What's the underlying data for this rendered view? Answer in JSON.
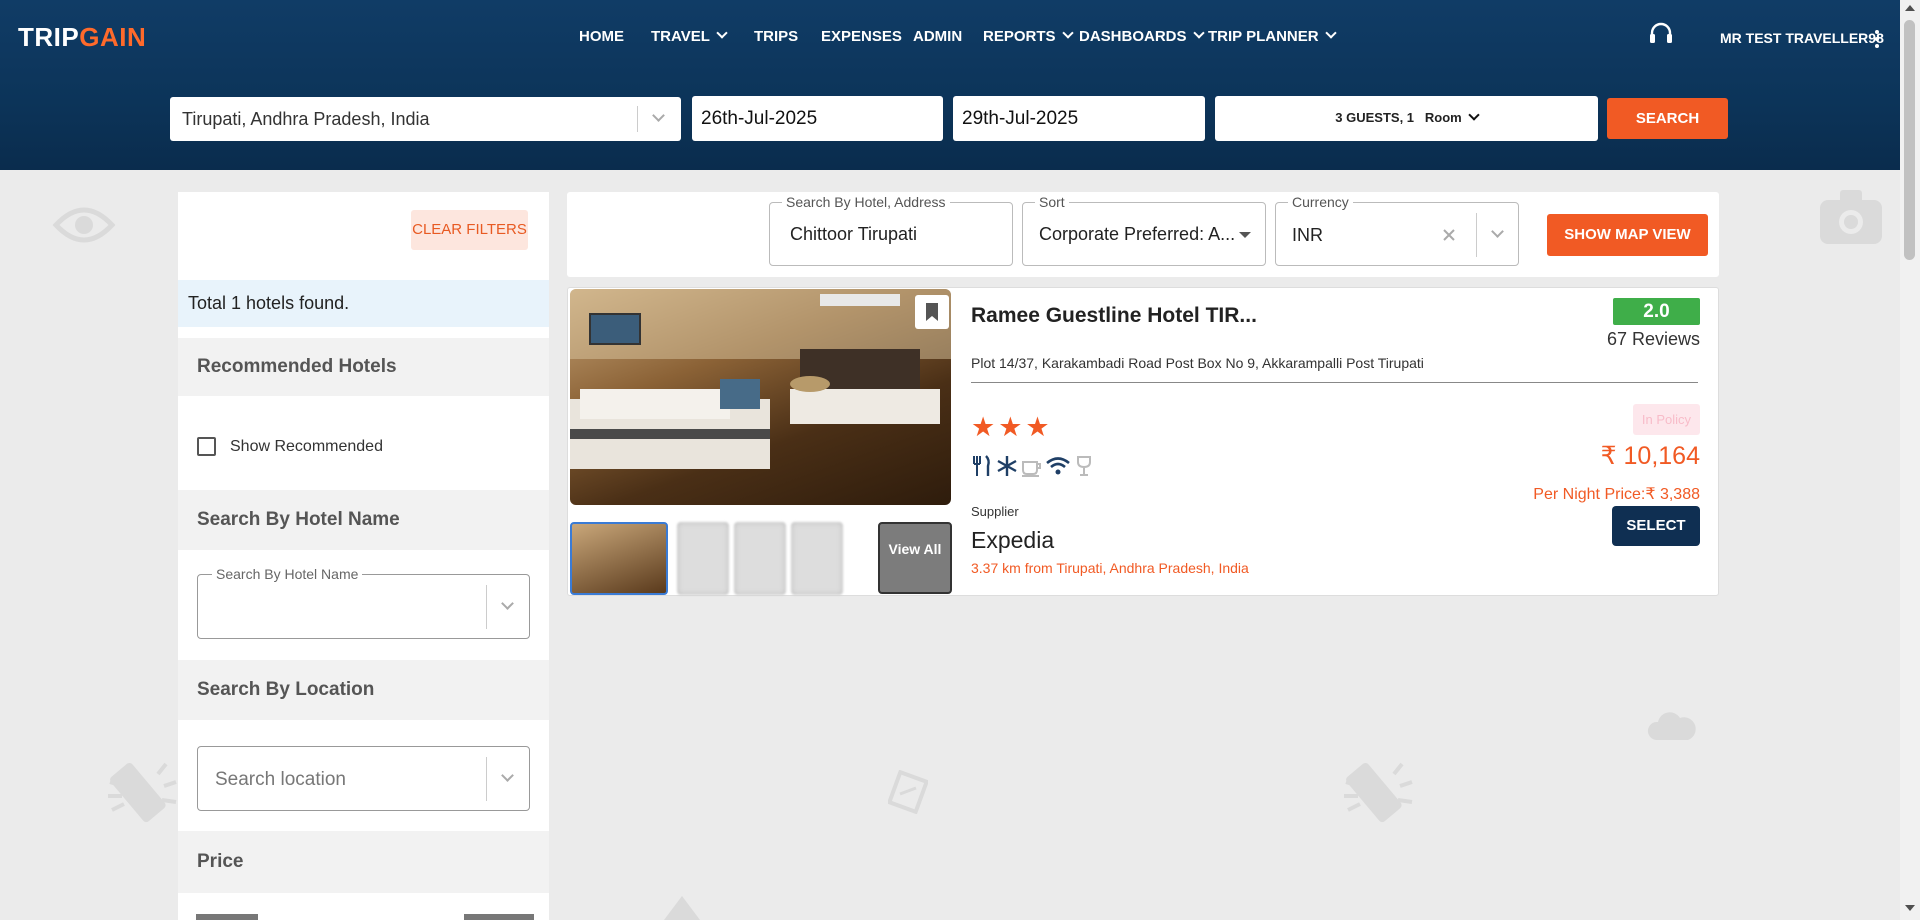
{
  "app": {
    "logo_main": "TRIP",
    "logo_accent": "GAIN",
    "user_name": "MR TEST TRAVELLER98"
  },
  "nav": {
    "items": [
      {
        "label": "HOME",
        "dropdown": false
      },
      {
        "label": "TRAVEL",
        "dropdown": true
      },
      {
        "label": "TRIPS",
        "dropdown": false
      },
      {
        "label": "EXPENSES",
        "dropdown": false
      },
      {
        "label": "ADMIN",
        "dropdown": false
      },
      {
        "label": "REPORTS",
        "dropdown": true
      },
      {
        "label": "DASHBOARDS",
        "dropdown": true
      },
      {
        "label": "TRIP PLANNER",
        "dropdown": true
      }
    ]
  },
  "search": {
    "destination": "Tirupati, Andhra Pradesh, India",
    "checkin": "26th-Jul-2025",
    "checkout": "29th-Jul-2025",
    "guests_prefix": "3 GUESTS, 1",
    "guests_room": "Room",
    "button": "SEARCH"
  },
  "filters": {
    "clear_label": "CLEAR FILTERS",
    "total_text": "Total 1 hotels found.",
    "recommended_heading": "Recommended Hotels",
    "show_recommended_label": "Show Recommended",
    "show_recommended_checked": false,
    "hotel_name_heading": "Search By Hotel Name",
    "hotel_name_legend": "Search By Hotel Name",
    "hotel_name_value": "",
    "location_heading": "Search By Location",
    "location_placeholder": "Search location",
    "price_heading": "Price"
  },
  "toolbar": {
    "search_legend": "Search By Hotel, Address",
    "search_value": "Chittoor Tirupati",
    "sort_legend": "Sort",
    "sort_value": "Corporate Preferred: A...",
    "currency_legend": "Currency",
    "currency_value": "INR",
    "map_button": "SHOW MAP VIEW"
  },
  "hotel": {
    "name": "Ramee Guestline Hotel TIR...",
    "address": "Plot 14/37, Karakambadi Road Post Box No 9, Akkarampalli Post Tirupati",
    "rating": "2.0",
    "reviews": "67 Reviews",
    "policy_badge": "In Policy",
    "stars": "★★★",
    "star_count": 3,
    "price": "₹ 10,164",
    "per_night": "Per Night Price:₹ 3,388",
    "supplier_label": "Supplier",
    "supplier": "Expedia",
    "distance": "3.37 km from Tirupati, Andhra Pradesh, India",
    "select_label": "SELECT",
    "view_all_label": "View All",
    "amenities": [
      "restaurant-icon",
      "ac-snowflake-icon",
      "coffee-icon",
      "wifi-icon",
      "bar-glass-icon"
    ]
  },
  "colors": {
    "header_bg": "#0c3459",
    "accent": "#f15a24",
    "rating_green": "#3fae49",
    "select_btn": "#0f2f52"
  }
}
